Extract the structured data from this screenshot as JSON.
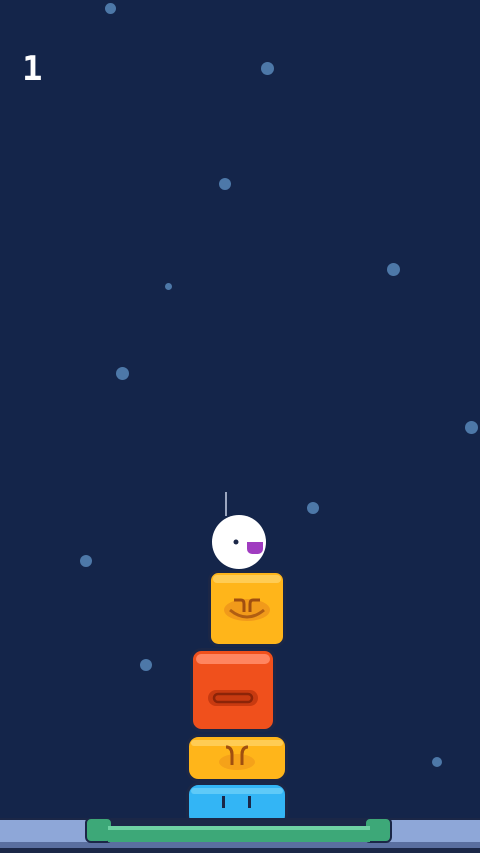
{
  "hud": {
    "score": "1"
  },
  "palette": {
    "background": "#14254a",
    "star": "#4d78a8",
    "block_yellow": "#ffb51a",
    "block_red": "#f0501c",
    "block_blue": "#33b5f5",
    "ground": "#8ea7d8",
    "platform": "#3da878",
    "ball": "#ffffff",
    "ball_mouth": "#a03cc0"
  },
  "stack": [
    {
      "name": "blue-block",
      "color": "block_blue",
      "face": "eyes"
    },
    {
      "name": "yellow-block-wide",
      "color": "block_yellow",
      "face": "brows"
    },
    {
      "name": "red-block",
      "color": "block_red",
      "face": "mouth"
    },
    {
      "name": "yellow-block-top",
      "color": "block_yellow",
      "face": "brows-mouth"
    }
  ],
  "player": {
    "name": "white-ball-character"
  }
}
